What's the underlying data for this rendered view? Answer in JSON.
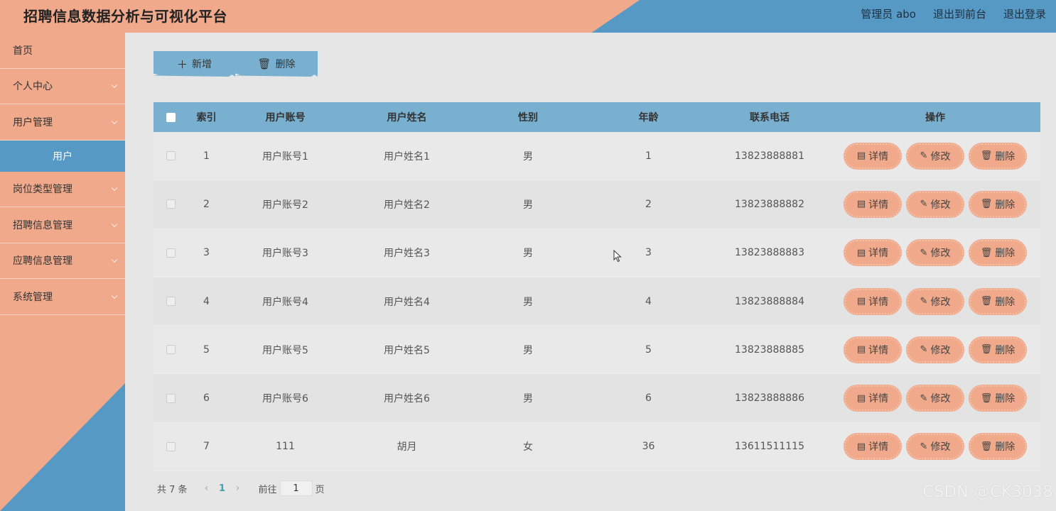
{
  "header": {
    "title": "招聘信息数据分析与可视化平台",
    "admin": "管理员 abo",
    "exit_front": "退出到前台",
    "logout": "退出登录"
  },
  "sidebar": {
    "items": [
      {
        "label": "首页",
        "has_chevron": false
      },
      {
        "label": "个人中心",
        "has_chevron": true
      },
      {
        "label": "用户管理",
        "has_chevron": true
      },
      {
        "label": "用户",
        "sub": true,
        "selected": true
      },
      {
        "label": "岗位类型管理",
        "has_chevron": true
      },
      {
        "label": "招聘信息管理",
        "has_chevron": true
      },
      {
        "label": "应聘信息管理",
        "has_chevron": true
      },
      {
        "label": "系统管理",
        "has_chevron": true
      }
    ]
  },
  "toolbar": {
    "add_label": "新增",
    "add_icon": "plus-icon",
    "delete_label": "删除",
    "delete_icon": "trash-icon"
  },
  "table": {
    "columns": [
      "索引",
      "用户账号",
      "用户姓名",
      "性别",
      "年龄",
      "联系电话",
      "操作"
    ],
    "rows": [
      {
        "idx": "1",
        "account": "用户账号1",
        "name": "用户姓名1",
        "sex": "男",
        "age": "1",
        "phone": "13823888881"
      },
      {
        "idx": "2",
        "account": "用户账号2",
        "name": "用户姓名2",
        "sex": "男",
        "age": "2",
        "phone": "13823888882"
      },
      {
        "idx": "3",
        "account": "用户账号3",
        "name": "用户姓名3",
        "sex": "男",
        "age": "3",
        "phone": "13823888883"
      },
      {
        "idx": "4",
        "account": "用户账号4",
        "name": "用户姓名4",
        "sex": "男",
        "age": "4",
        "phone": "13823888884"
      },
      {
        "idx": "5",
        "account": "用户账号5",
        "name": "用户姓名5",
        "sex": "男",
        "age": "5",
        "phone": "13823888885"
      },
      {
        "idx": "6",
        "account": "用户账号6",
        "name": "用户姓名6",
        "sex": "男",
        "age": "6",
        "phone": "13823888886"
      },
      {
        "idx": "7",
        "account": "111",
        "name": "胡月",
        "sex": "女",
        "age": "36",
        "phone": "13611511115"
      }
    ],
    "actions": {
      "detail": "详情",
      "edit": "修改",
      "delete": "删除"
    }
  },
  "pager": {
    "total": "共 7 条",
    "current": "1",
    "goto_prefix": "前往",
    "goto_value": "1",
    "goto_suffix": "页"
  },
  "watermark": "CSDN @CK3038",
  "colors": {
    "salmon": "#f0a98a",
    "blue": "#5599c4",
    "light_blue": "#7ab0cf",
    "background": "#e6e6e6"
  }
}
